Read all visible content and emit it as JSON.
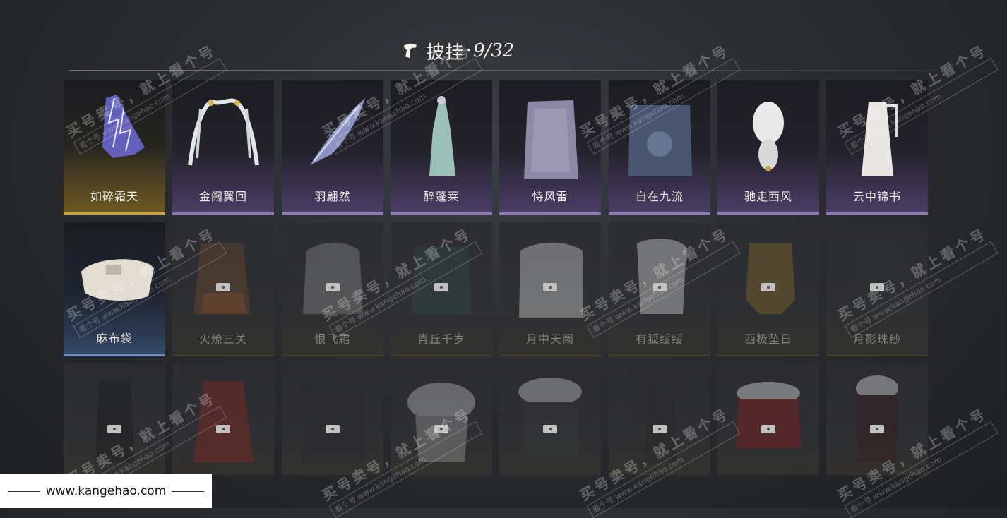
{
  "header": {
    "title": "披挂",
    "separator": "·",
    "count": "9/32"
  },
  "grid": {
    "rows": [
      [
        {
          "name": "如碎霜天",
          "owned": true,
          "tint": "gold",
          "icon": "lightning-cape-icon"
        },
        {
          "name": "金阙翼回",
          "owned": true,
          "tint": "purple",
          "icon": "silk-arch-icon"
        },
        {
          "name": "羽翩然",
          "owned": true,
          "tint": "purple",
          "icon": "feather-scarf-icon"
        },
        {
          "name": "醉蓬莱",
          "owned": true,
          "tint": "purple",
          "icon": "robe-figure-icon"
        },
        {
          "name": "恃风雷",
          "owned": true,
          "tint": "purple",
          "icon": "long-coat-icon"
        },
        {
          "name": "自在九流",
          "owned": true,
          "tint": "purple",
          "icon": "embroidered-robe-icon"
        },
        {
          "name": "驰走西风",
          "owned": true,
          "tint": "purple",
          "icon": "fur-stole-icon"
        },
        {
          "name": "云中锦书",
          "owned": true,
          "tint": "purple",
          "icon": "white-robe-icon"
        }
      ],
      [
        {
          "name": "麻布袋",
          "owned": true,
          "tint": "blue",
          "icon": "burlap-sack-icon"
        },
        {
          "name": "火燎三关",
          "owned": false,
          "tint": "gold",
          "icon": "flame-cape-icon"
        },
        {
          "name": "恨飞霜",
          "owned": false,
          "tint": "gold",
          "icon": "grey-fur-icon"
        },
        {
          "name": "青丘千岁",
          "owned": false,
          "tint": "gold",
          "icon": "green-robe-icon"
        },
        {
          "name": "月中天阙",
          "owned": false,
          "tint": "gold",
          "icon": "white-cape-icon"
        },
        {
          "name": "有狐绥绥",
          "owned": false,
          "tint": "gold",
          "icon": "fox-fur-icon"
        },
        {
          "name": "西极坠日",
          "owned": false,
          "tint": "gold",
          "icon": "golden-scarf-icon"
        },
        {
          "name": "月影珠纱",
          "owned": false,
          "tint": "gold",
          "icon": "dark-veil-icon"
        }
      ],
      [
        {
          "name": "",
          "owned": false,
          "tint": "none",
          "icon": "black-robe-icon"
        },
        {
          "name": "",
          "owned": false,
          "tint": "none",
          "icon": "red-cape-icon"
        },
        {
          "name": "",
          "owned": false,
          "tint": "none",
          "icon": "dark-cloak-icon"
        },
        {
          "name": "",
          "owned": false,
          "tint": "none",
          "icon": "spotted-fur-icon"
        },
        {
          "name": "",
          "owned": false,
          "tint": "none",
          "icon": "fur-collar-cape-icon"
        },
        {
          "name": "",
          "owned": false,
          "tint": "none",
          "icon": "thin-robe-icon"
        },
        {
          "name": "",
          "owned": false,
          "tint": "none",
          "icon": "red-fur-cape-icon"
        },
        {
          "name": "",
          "owned": false,
          "tint": "none",
          "icon": "dark-fur-cape-icon"
        }
      ]
    ]
  },
  "watermark": {
    "line1": "买号卖号，就上看个号",
    "line2": "看个号 www.kangehao.com"
  },
  "footer": {
    "site": "www.kangehao.com"
  },
  "colors": {
    "gold": "#c9a23c",
    "purple": "#8c7ab3",
    "blue": "#6f8fbf"
  }
}
